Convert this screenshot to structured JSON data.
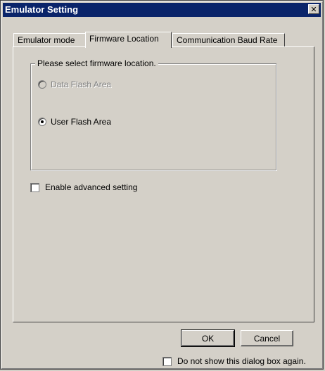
{
  "window": {
    "title": "Emulator Setting",
    "close_glyph": "✕"
  },
  "tabs": [
    {
      "label": "Emulator mode"
    },
    {
      "label": "Firmware Location"
    },
    {
      "label": "Communication Baud Rate"
    }
  ],
  "firmware": {
    "group_label": "Please select firmware location.",
    "options": [
      {
        "label": "Data Flash Area",
        "enabled": false,
        "checked": false
      },
      {
        "label": "User Flash Area",
        "enabled": true,
        "checked": true
      }
    ]
  },
  "advanced": {
    "label": "Enable advanced setting",
    "checked": false
  },
  "buttons": {
    "ok": "OK",
    "cancel": "Cancel"
  },
  "footer": {
    "dont_show_label": "Do not show this dialog box again.",
    "checked": false
  }
}
